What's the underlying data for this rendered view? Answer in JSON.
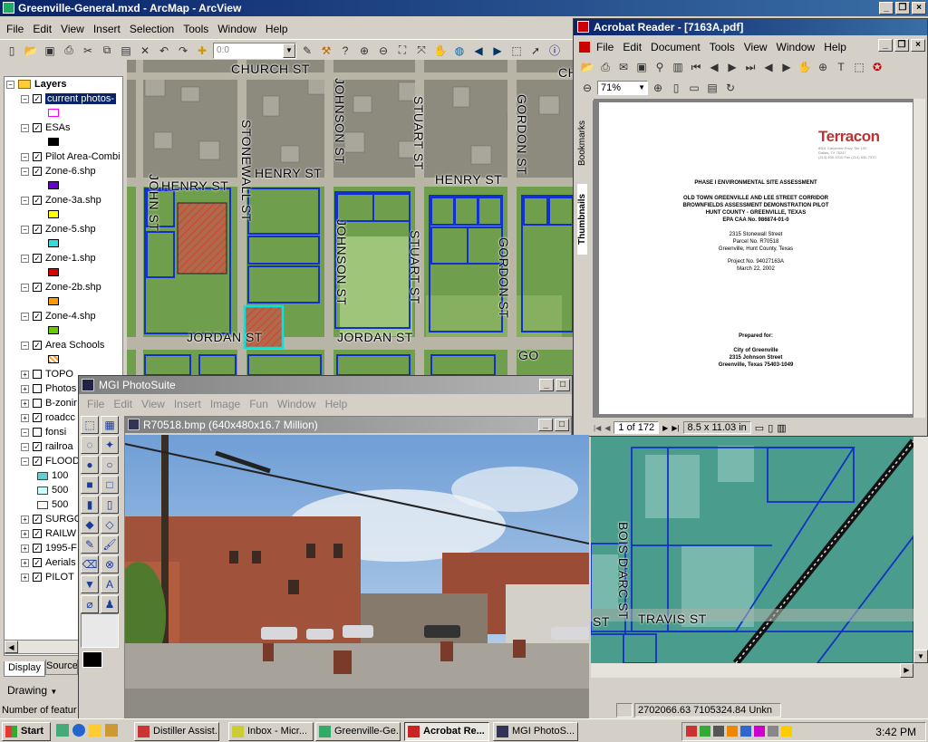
{
  "arcmap": {
    "title": "Greenville-General.mxd - ArcMap - ArcView",
    "menu": [
      "File",
      "Edit",
      "View",
      "Insert",
      "Selection",
      "Tools",
      "Window",
      "Help"
    ],
    "scale_value": "0:0",
    "toc_header": "Layers",
    "layers": [
      {
        "label": "current photos-",
        "checked": true,
        "expanded": true,
        "selected": true,
        "swatch": "#ff00ff"
      },
      {
        "label": "ESAs",
        "checked": true,
        "expanded": true,
        "swatch": "#000000"
      },
      {
        "label": "Pilot Area-Combi",
        "checked": true,
        "expanded": true
      },
      {
        "label": "Zone-6.shp",
        "checked": true,
        "expanded": true,
        "swatch": "#6600cc"
      },
      {
        "label": "Zone-3a.shp",
        "checked": true,
        "expanded": true,
        "swatch": "#ffff00"
      },
      {
        "label": "Zone-5.shp",
        "checked": true,
        "expanded": true,
        "swatch": "#33dddd"
      },
      {
        "label": "Zone-1.shp",
        "checked": true,
        "expanded": true,
        "swatch": "#dd0000"
      },
      {
        "label": "Zone-2b.shp",
        "checked": true,
        "expanded": true,
        "swatch": "#ff9900"
      },
      {
        "label": "Zone-4.shp",
        "checked": true,
        "expanded": true,
        "swatch": "#66cc00"
      },
      {
        "label": "Area Schools",
        "checked": true,
        "expanded": true,
        "swatch": "#ff9933"
      },
      {
        "label": "TOPO",
        "checked": false,
        "expanded": false
      },
      {
        "label": "Photos",
        "checked": false,
        "expanded": false
      },
      {
        "label": "B-zonir",
        "checked": false,
        "expanded": false
      },
      {
        "label": "roadcc",
        "checked": true,
        "expanded": false
      },
      {
        "label": "fonsi",
        "checked": false,
        "expanded": true
      },
      {
        "label": "railroa",
        "checked": true,
        "expanded": true
      },
      {
        "label": "FLOOD",
        "checked": true,
        "expanded": true
      },
      {
        "label": "100",
        "checked": false,
        "expanded": false,
        "sub": true,
        "swatch": "#66cccc"
      },
      {
        "label": "500",
        "checked": false,
        "expanded": false,
        "sub": true,
        "swatch": "#ccffff"
      },
      {
        "label": "500",
        "checked": false,
        "expanded": false,
        "sub": true,
        "swatch": "#ffffff"
      },
      {
        "label": "SURGO",
        "checked": true,
        "expanded": false
      },
      {
        "label": "RAILW",
        "checked": true,
        "expanded": false
      },
      {
        "label": "1995-F",
        "checked": true,
        "expanded": false
      },
      {
        "label": "Aerials",
        "checked": true,
        "expanded": false
      },
      {
        "label": "PILOT",
        "checked": true,
        "expanded": false
      }
    ],
    "tabs": [
      "Display",
      "Source"
    ],
    "drawing_label": "Drawing",
    "status_left": "Number of featur",
    "status_coords": "2702066.63  7105324.84 Unkn",
    "streets": [
      "CHURCH ST",
      "HENRY ST",
      "HENRY ST",
      "HENRY ST",
      "JORDAN ST",
      "JORDAN ST",
      "JOHNSON ST",
      "JOHNSON ST",
      "STONEWALL ST",
      "STUART ST",
      "STUART ST",
      "GORDON ST",
      "GORDON ST",
      "JOHN ST",
      "BOIS D'ARC ST",
      "TRAVIS ST",
      "CH",
      "GO",
      "ST"
    ]
  },
  "acrobat": {
    "title": "Acrobat Reader - [7163A.pdf]",
    "menu": [
      "File",
      "Edit",
      "Document",
      "Tools",
      "View",
      "Window",
      "Help"
    ],
    "zoom": "71%",
    "side_tabs": [
      "Bookmarks",
      "Thumbnails"
    ],
    "page_indicator": "1 of 172",
    "page_size": "8.5 x 11.03 in",
    "doc": {
      "logo": "Terracon",
      "address": [
        "8901 Carpenter Frwy. Ste 100",
        "Dallas, TX 75247",
        "(214) 630-1010  Fax (214) 630-7070"
      ],
      "title": "PHASE I ENVIRONMENTAL SITE ASSESSMENT",
      "project_lines": [
        "OLD TOWN GREENVILLE AND LEE STREET CORRIDOR",
        "BROWNFIELDS ASSESSMENT DEMONSTRATION PILOT",
        "HUNT COUNTY - GREENVILLE, TEXAS",
        "EPA CAA No. 986874-01-0"
      ],
      "site_lines": [
        "2315 Stonewall Street",
        "Parcel No. R70518",
        "Greenville, Hunt County, Texas"
      ],
      "project_no": [
        "Project No. 94027163A",
        "March 22, 2002"
      ],
      "prepared_label": "Prepared for:",
      "prepared_lines": [
        "City of Greenville",
        "2315 Johnson Street",
        "Greenville, Texas 75403-1049"
      ]
    }
  },
  "photosuite": {
    "title": "MGI PhotoSuite",
    "menu": [
      "File",
      "Edit",
      "View",
      "Insert",
      "Image",
      "Fun",
      "Window",
      "Help"
    ],
    "image_title": "R70518.bmp (640x480x16.7 Million)"
  },
  "taskbar": {
    "start": "Start",
    "tasks": [
      "Distiller Assist...",
      "Inbox - Micr...",
      "Greenville-Ge...",
      "Acrobat Re...",
      "MGI PhotoS..."
    ],
    "active_task": 3,
    "clock": "3:42 PM"
  }
}
